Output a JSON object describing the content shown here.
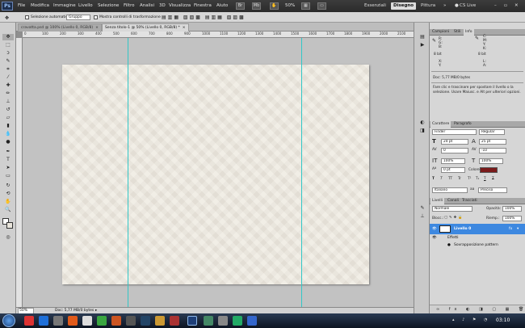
{
  "menubar": {
    "items": [
      "File",
      "Modifica",
      "Immagine",
      "Livello",
      "Selezione",
      "Filtro",
      "Analisi",
      "3D",
      "Visualizza",
      "Finestra",
      "Aiuto"
    ],
    "zoom": "50%",
    "workspaces": [
      "Essenziali",
      "Disegno",
      "Pittura"
    ],
    "cslive": "CS Live"
  },
  "options": {
    "auto_select_label": "Selezione automatica:",
    "auto_select_value": "Gruppo",
    "show_transform_label": "Mostra controlli di trasformazione"
  },
  "tabs": [
    {
      "label": "cravatta.psd @ 100% (Livello 0, RGB/8)",
      "close": "×"
    },
    {
      "label": "Senza titolo-1 @ 50% (Livello 0, RGB/8) *",
      "close": "×"
    }
  ],
  "ruler_top": [
    "0",
    "100",
    "200",
    "300",
    "400",
    "500",
    "600",
    "700",
    "800",
    "900",
    "1000",
    "1100",
    "1200",
    "1300",
    "1400",
    "1500",
    "1600",
    "1700",
    "1800",
    "1900",
    "2000",
    "2100"
  ],
  "status": {
    "zoom": "50%",
    "doc": "Doc: 5,77 MB/0 bytes"
  },
  "info_panel": {
    "tabs": [
      "Campioni",
      "Stili",
      "Info"
    ],
    "left": [
      "R:",
      "G:",
      "B:",
      "8 bit",
      "X:",
      "Y:"
    ],
    "right": [
      "C:",
      "M:",
      "Y:",
      "K:",
      "8 bit",
      "L:",
      "A:"
    ],
    "doc": "Doc: 5,77 MB/0 bytes",
    "hint": "Fare clic e trascinare per spostare il livello o la selezione. Usare Maiusc. e Alt per ulteriori opzioni."
  },
  "char_panel": {
    "tabs": [
      "Carattere",
      "Paragrafo"
    ],
    "font": "Finder",
    "style": "Regular",
    "size": "24 pt",
    "leading": "25 pt",
    "kerning": "0",
    "tracking": "-10",
    "scale_v": "100%",
    "scale_h": "100%",
    "baseline": "0 pt",
    "color_label": "Colore:",
    "color": "#7a1a1a",
    "styles": [
      "T",
      "T",
      "TT",
      "Tr",
      "T¹",
      "T₁",
      "T",
      "T"
    ],
    "lang": "Italiano",
    "aa_icon": "aa",
    "aa": "Preciso"
  },
  "layers_panel": {
    "tabs": [
      "Livelli",
      "Canali",
      "Tracciati"
    ],
    "blend": "Normale",
    "opacity_label": "Opacità:",
    "opacity": "100%",
    "lock_label": "Blocc.:",
    "fill_label": "Riemp.:",
    "fill": "100%",
    "layer_name": "Livello 0",
    "effects_label": "Effetti",
    "effect_item": "Sovrapposizione pattern"
  },
  "taskbar": {
    "clock": "03:10"
  },
  "accent": "#3d88e0"
}
